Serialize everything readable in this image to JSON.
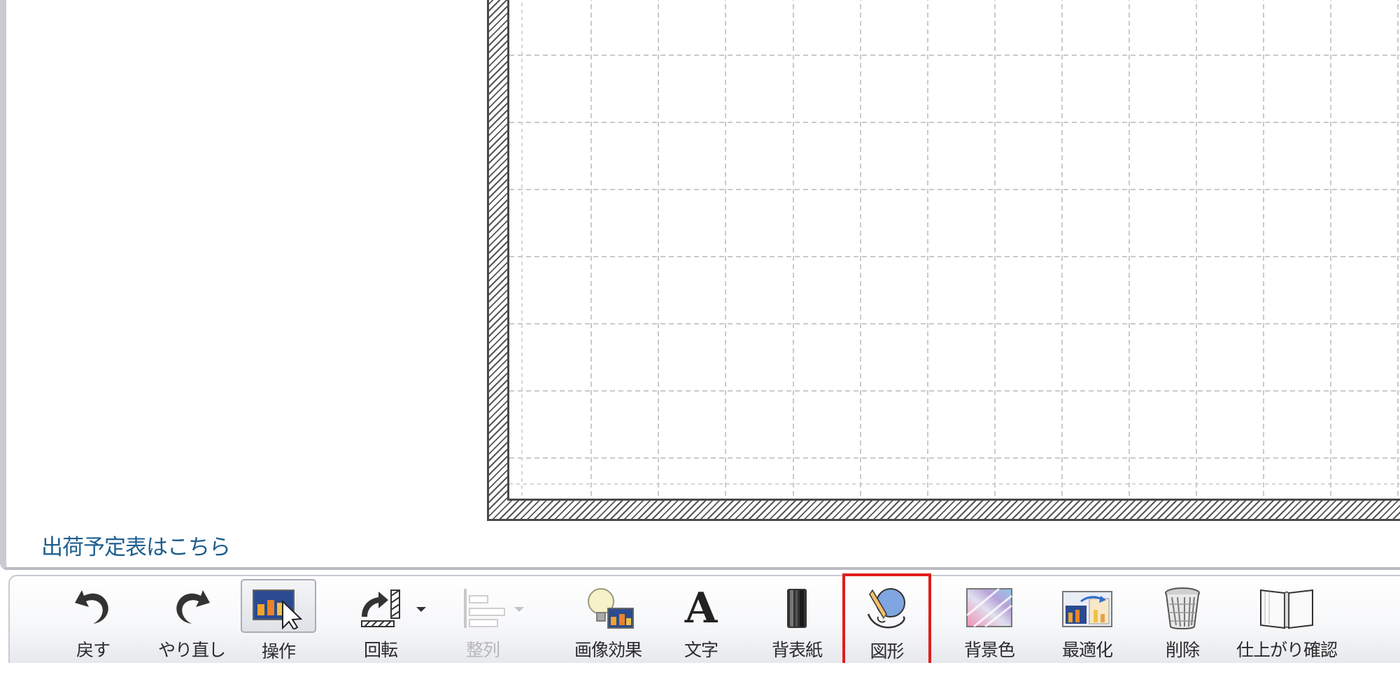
{
  "workspace": {
    "shipping_link": "出荷予定表はこちら"
  },
  "toolbar": {
    "buttons": [
      {
        "label": "戻す",
        "icon": "undo-icon",
        "state": "normal"
      },
      {
        "label": "やり直し",
        "icon": "redo-icon",
        "state": "normal"
      },
      {
        "label": "操作",
        "icon": "pointer-photo-icon",
        "state": "pressed"
      },
      {
        "label": "回転",
        "icon": "rotate-icon",
        "state": "normal",
        "has_dropdown": true
      },
      {
        "label": "整列",
        "icon": "align-icon",
        "state": "disabled",
        "has_dropdown": true
      },
      {
        "label": "画像効果",
        "icon": "image-effect-icon",
        "state": "normal"
      },
      {
        "label": "文字",
        "icon": "text-a-icon",
        "state": "normal"
      },
      {
        "label": "背表紙",
        "icon": "spine-book-icon",
        "state": "normal"
      },
      {
        "label": "図形",
        "icon": "shape-pencil-icon",
        "state": "selected"
      },
      {
        "label": "背景色",
        "icon": "background-gradient-icon",
        "state": "normal"
      },
      {
        "label": "最適化",
        "icon": "optimize-photo-icon",
        "state": "normal"
      },
      {
        "label": "削除",
        "icon": "trash-can-icon",
        "state": "normal"
      },
      {
        "label": "仕上がり確認",
        "icon": "open-book-icon",
        "state": "normal"
      }
    ]
  },
  "colors": {
    "link": "#1f5f8f",
    "selection_highlight": "#e01d1d",
    "toolbar_border": "#c7cad0"
  }
}
